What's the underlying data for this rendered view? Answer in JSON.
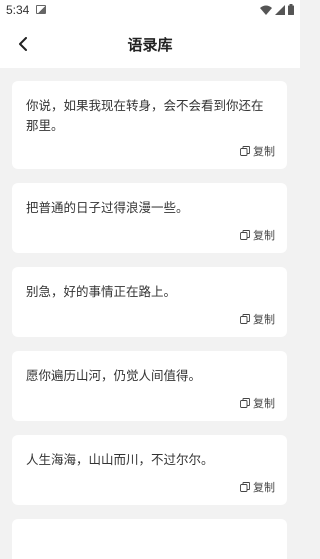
{
  "status_bar": {
    "time": "5:34"
  },
  "header": {
    "title": "语录库",
    "back_icon": "chevron-left-icon"
  },
  "quotes": [
    {
      "text": "你说，如果我现在转身，会不会看到你还在那里。",
      "copy_label": "复制"
    },
    {
      "text": "把普通的日子过得浪漫一些。",
      "copy_label": "复制"
    },
    {
      "text": "别急，好的事情正在路上。",
      "copy_label": "复制"
    },
    {
      "text": "愿你遍历山河，仍觉人间值得。",
      "copy_label": "复制"
    },
    {
      "text": "人生海海，山山而川，不过尔尔。",
      "copy_label": "复制"
    }
  ]
}
